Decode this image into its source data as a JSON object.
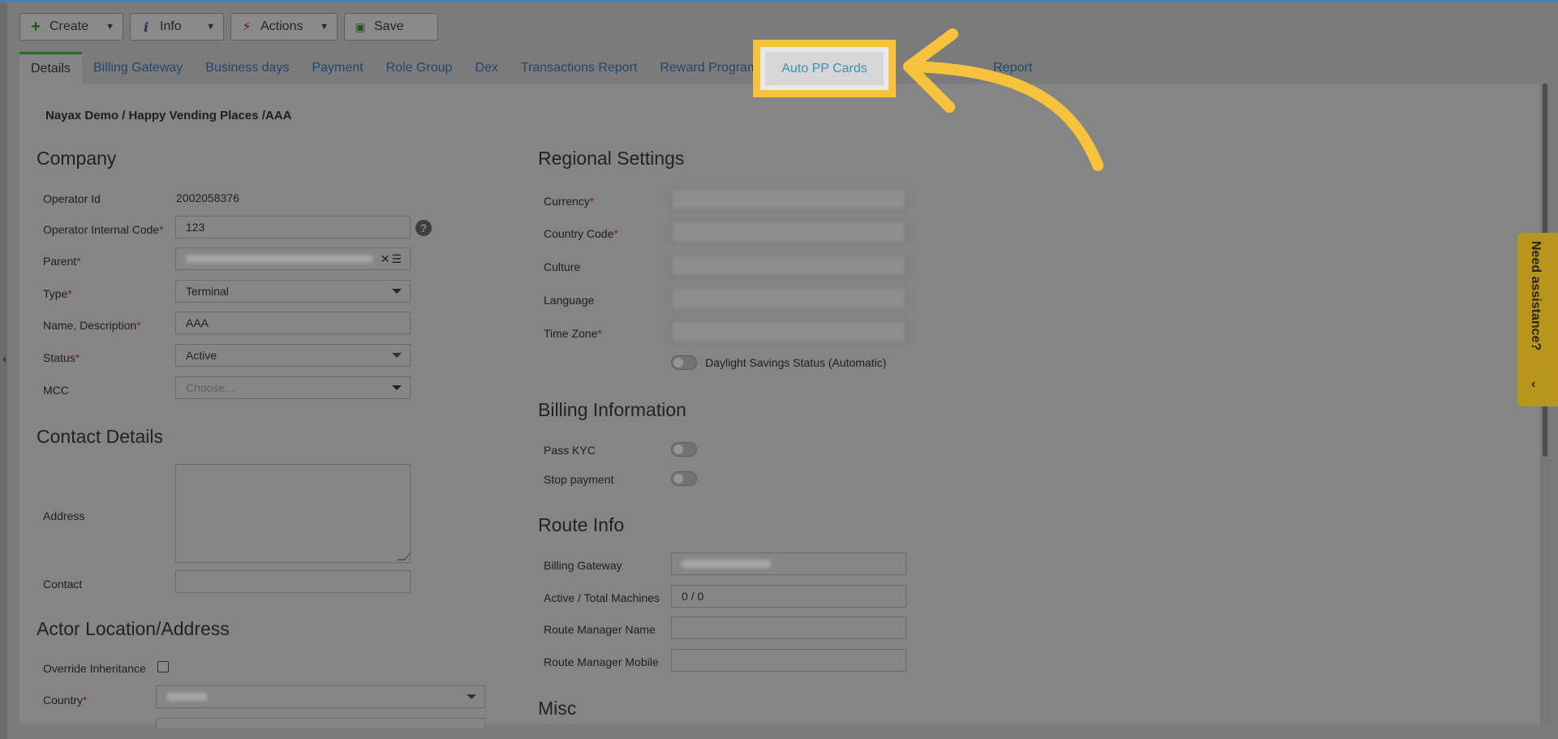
{
  "toolbar": {
    "create_label": "Create",
    "info_label": "Info",
    "actions_label": "Actions",
    "save_label": "Save"
  },
  "tabs": [
    {
      "label": "Details",
      "active": true
    },
    {
      "label": "Billing Gateway"
    },
    {
      "label": "Business days"
    },
    {
      "label": "Payment"
    },
    {
      "label": "Role Group"
    },
    {
      "label": "Dex"
    },
    {
      "label": "Transactions Report"
    },
    {
      "label": "Reward Program"
    },
    {
      "label": "Auto PP Cards",
      "highlighted": true
    },
    {
      "label": "Report"
    }
  ],
  "breadcrumb": "Nayax Demo / Happy Vending Places /AAA",
  "company": {
    "title": "Company",
    "operator_id_label": "Operator Id",
    "operator_id_value": "2002058376",
    "internal_code_label": "Operator Internal Code",
    "internal_code_value": "123",
    "parent_label": "Parent",
    "type_label": "Type",
    "type_value": "Terminal",
    "name_label": "Name, Description",
    "name_value": "AAA",
    "status_label": "Status",
    "status_value": "Active",
    "mcc_label": "MCC",
    "mcc_placeholder": "Choose..."
  },
  "contact": {
    "title": "Contact Details",
    "address_label": "Address",
    "contact_label": "Contact"
  },
  "location": {
    "title": "Actor Location/Address",
    "override_label": "Override Inheritance",
    "country_label": "Country"
  },
  "regional": {
    "title": "Regional Settings",
    "currency_label": "Currency",
    "country_code_label": "Country Code",
    "culture_label": "Culture",
    "language_label": "Language",
    "timezone_label": "Time Zone",
    "dst_label": "Daylight Savings Status (Automatic)"
  },
  "billing": {
    "title": "Billing Information",
    "kyc_label": "Pass KYC",
    "stop_label": "Stop payment"
  },
  "route": {
    "title": "Route Info",
    "gateway_label": "Billing Gateway",
    "machines_label": "Active / Total Machines",
    "machines_value": "0 / 0",
    "manager_name_label": "Route Manager Name",
    "manager_mobile_label": "Route Manager Mobile"
  },
  "misc": {
    "title": "Misc"
  },
  "assist": {
    "label": "Need assistance?"
  },
  "colors": {
    "highlight": "#f7c23c",
    "assist": "#b8961e",
    "link": "#1f4670"
  }
}
